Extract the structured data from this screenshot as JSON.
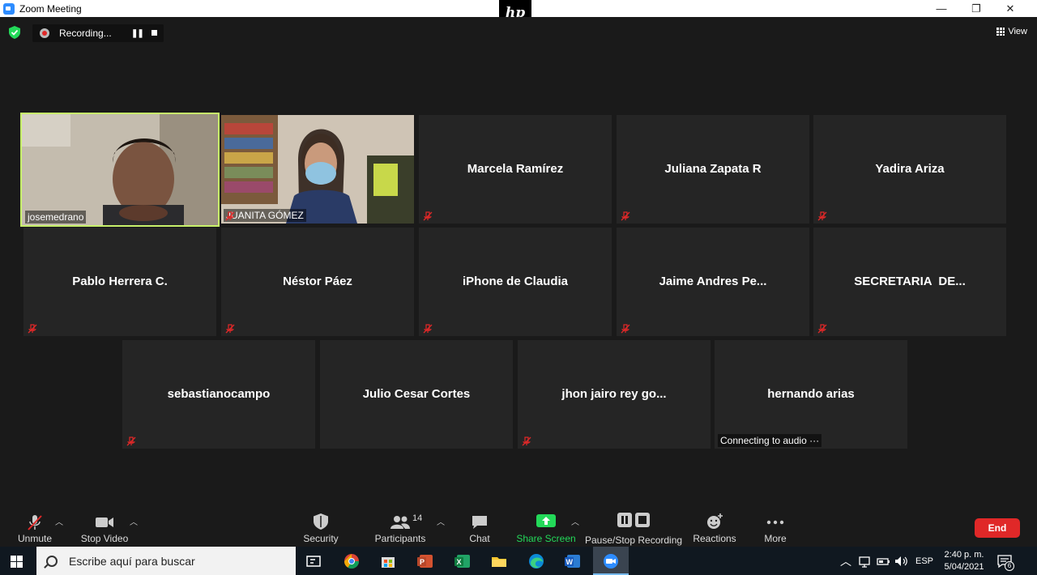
{
  "window": {
    "title": "Zoom Meeting",
    "minimize": "—",
    "restore": "❐",
    "close": "✕"
  },
  "hp_logo_text": "hp",
  "recording": {
    "label": "Recording...",
    "pause": "❚❚"
  },
  "view_label": "View",
  "participants": [
    {
      "name": "josemedrano",
      "video": true,
      "active": true
    },
    {
      "name": "JUANITA GÓMEZ",
      "video": true,
      "muted": true
    },
    {
      "name": "Marcela Ramírez",
      "muted": true
    },
    {
      "name": "Juliana Zapata R",
      "muted": true
    },
    {
      "name": "Yadira Ariza",
      "muted": true
    },
    {
      "name": "Pablo Herrera C.",
      "muted": true
    },
    {
      "name": "Néstor Páez",
      "muted": true
    },
    {
      "name": "iPhone de Claudia",
      "muted": true
    },
    {
      "name": "Jaime Andres Pe...",
      "muted": true
    },
    {
      "name": "SECRETARIA  DE...",
      "muted": true
    },
    {
      "name": "sebastianocampo",
      "muted": true
    },
    {
      "name": "Julio Cesar Cortes",
      "muted": false
    },
    {
      "name": "jhon jairo rey go...",
      "muted": true
    },
    {
      "name": "hernando arias",
      "status": "Connecting to audio ···"
    }
  ],
  "controls": {
    "unmute": "Unmute",
    "stop_video": "Stop Video",
    "security": "Security",
    "participants": "Participants",
    "participants_count": "14",
    "chat": "Chat",
    "share_screen": "Share Screen",
    "pause_stop_recording": "Pause/Stop Recording",
    "reactions": "Reactions",
    "more": "More",
    "end": "End"
  },
  "colors": {
    "active_speaker": "#c8f16b",
    "end_button": "#e02828",
    "share_screen": "#23d959",
    "mute_icon": "#e02828"
  },
  "taskbar": {
    "search_placeholder": "Escribe aquí para buscar",
    "language": "ESP",
    "time": "2:40 p. m.",
    "date": "5/04/2021",
    "notifications": "6"
  }
}
